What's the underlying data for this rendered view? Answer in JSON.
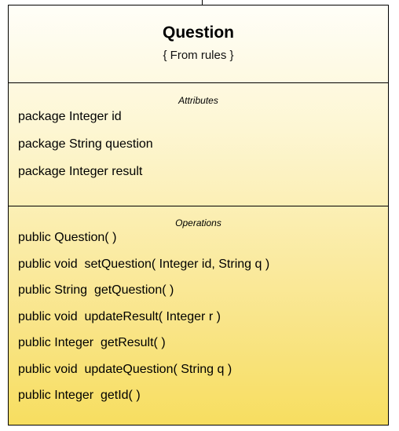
{
  "class": {
    "name": "Question",
    "stereotype": "{ From rules }"
  },
  "attributes": {
    "title": "Attributes",
    "items": [
      "package Integer id",
      "package String question",
      "package Integer result"
    ]
  },
  "operations": {
    "title": "Operations",
    "items": [
      "public Question( )",
      "public void  setQuestion( Integer id, String q )",
      "public String  getQuestion( )",
      "public void  updateResult( Integer r )",
      "public Integer  getResult( )",
      "public void  updateQuestion( String q )",
      "public Integer  getId( )"
    ]
  },
  "colors": {
    "border": "#000000",
    "fill_top": "#fffef8",
    "fill_bottom": "#f7de60"
  }
}
